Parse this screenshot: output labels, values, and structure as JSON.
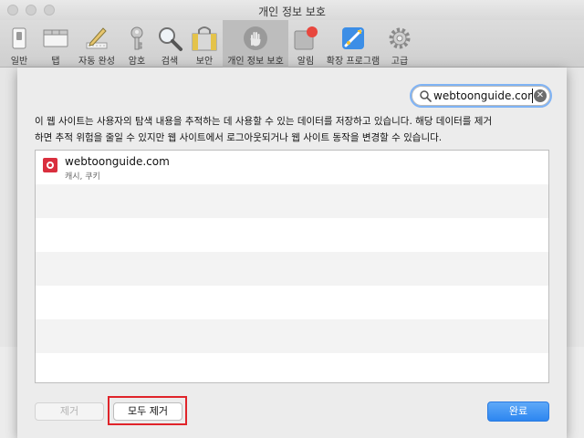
{
  "window": {
    "title": "개인 정보 보호"
  },
  "toolbar": {
    "items": [
      {
        "label": "일반",
        "icon": "general-switch-icon"
      },
      {
        "label": "탭",
        "icon": "tabs-icon"
      },
      {
        "label": "자동 완성",
        "icon": "autofill-pencil-icon"
      },
      {
        "label": "암호",
        "icon": "key-icon"
      },
      {
        "label": "검색",
        "icon": "magnifier-icon"
      },
      {
        "label": "보안",
        "icon": "security-lock-icon"
      },
      {
        "label": "개인 정보 보호",
        "icon": "privacy-hand-icon",
        "active": true
      },
      {
        "label": "알림",
        "icon": "notification-icon"
      },
      {
        "label": "확장 프로그램",
        "icon": "extensions-icon"
      },
      {
        "label": "고급",
        "icon": "advanced-gear-icon"
      }
    ]
  },
  "search": {
    "value": "webtoonguide.com"
  },
  "description": {
    "line1": "이 웹 사이트는 사용자의 탐색 내용을 추적하는 데 사용할 수 있는 데이터를 저장하고 있습니다. 해당 데이터를 제거",
    "line2": "하면 추적 위험을 줄일 수 있지만 웹 사이트에서 로그아웃되거나 웹 사이트 동작을 변경할 수 있습니다."
  },
  "sites": [
    {
      "name": "webtoonguide.com",
      "detail": "캐시, 쿠키"
    }
  ],
  "buttons": {
    "remove": "제거",
    "remove_all": "모두 제거",
    "done": "완료"
  },
  "colors": {
    "accent": "#2d86f0",
    "highlight": "#e0242a",
    "favicon": "#d92f3e"
  }
}
